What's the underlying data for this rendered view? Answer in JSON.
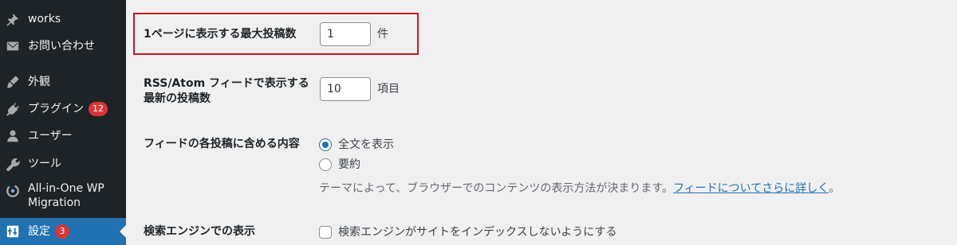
{
  "sidebar": {
    "items": [
      {
        "label": "works",
        "icon": "pin-icon"
      },
      {
        "label": "お問い合わせ",
        "icon": "mail-icon"
      },
      {
        "label": "外観",
        "icon": "brush-icon"
      },
      {
        "label": "プラグイン",
        "icon": "plugin-icon",
        "badge": "12"
      },
      {
        "label": "ユーザー",
        "icon": "user-icon"
      },
      {
        "label": "ツール",
        "icon": "wrench-icon"
      },
      {
        "label": "All-in-One WP Migration",
        "icon": "migration-icon"
      },
      {
        "label": "設定",
        "icon": "settings-icon",
        "badge": "3",
        "current": true
      }
    ]
  },
  "settings": {
    "posts_per_page": {
      "label": "1ページに表示する最大投稿数",
      "value": "1",
      "unit": "件"
    },
    "posts_per_rss": {
      "label_line1": "RSS/Atom フィードで表示する",
      "label_line2": "最新の投稿数",
      "value": "10",
      "unit": "項目"
    },
    "rss_use_excerpt": {
      "label": "フィードの各投稿に含める内容",
      "options": [
        {
          "label": "全文を表示",
          "checked": true
        },
        {
          "label": "要約",
          "checked": false
        }
      ],
      "description": "テーマによって、ブラウザーでのコンテンツの表示方法が決まります。",
      "link_text": "フィードについてさらに詳しく",
      "after_link": "。"
    },
    "blog_public": {
      "label": "検索エンジンでの表示",
      "checkbox_label": "検索エンジンがサイトをインデックスしないようにする",
      "checked": false
    }
  },
  "colors": {
    "sidebar_bg": "#1d2327",
    "accent": "#2271b1",
    "badge": "#d63638",
    "highlight": "#c8171f"
  }
}
